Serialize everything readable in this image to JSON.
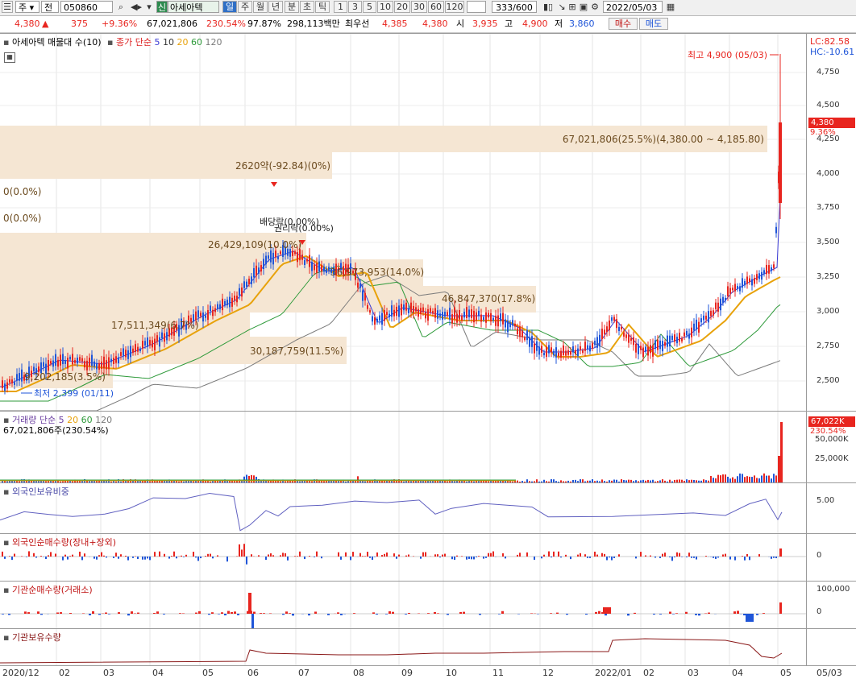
{
  "toolbar": {
    "menu_item": "주",
    "code": "050860",
    "prev_label": "전",
    "market_badge": "신",
    "stock_name": "아세아텍",
    "periods": [
      "일",
      "주",
      "월",
      "년",
      "분",
      "초",
      "틱"
    ],
    "intervals": [
      "1",
      "3",
      "5",
      "10",
      "20",
      "30",
      "60",
      "120"
    ],
    "count": "333/600",
    "date": "2022/05/03"
  },
  "quote": {
    "price": "4,380",
    "change": "375",
    "change_pct": "+9.36%",
    "volume": "67,021,806",
    "volume_ratio": "230.54%",
    "ratio2": "97.87%",
    "amount": "298,113백만",
    "best_label": "최우선",
    "best1": "4,385",
    "best2": "4,380",
    "open_label": "시",
    "open": "3,935",
    "high_label": "고",
    "high": "4,900",
    "low_label": "저",
    "low": "3,860",
    "buy": "매수",
    "sell": "매도"
  },
  "main": {
    "title": "아세아텍 매물대 수(10)",
    "ma_label": "종가 단순",
    "ma_periods": [
      "5",
      "10",
      "20",
      "60",
      "120"
    ],
    "lc": "LC:82.58",
    "hc": "HC:-10.61",
    "high_marker": "최고 4,900 (05/03)",
    "low_marker": "최저 2,399 (01/11)",
    "price_tag": "4,380",
    "price_tag_pct": "9.36%",
    "y_ticks": [
      "4,750",
      "4,500",
      "4,250",
      "4,000",
      "3,750",
      "3,500",
      "3,250",
      "3,000",
      "2,750",
      "2,500"
    ],
    "volume_profile": [
      {
        "label": "67,021,806(25.5%)(4,380.00 ~ 4,185.80)"
      },
      {
        "label": "2620약(-92.84)(0%)"
      },
      {
        "label": "0(0.0%)"
      },
      {
        "label": "0(0.0%)"
      },
      {
        "label": "26,429,109(10.0%)"
      },
      {
        "label": "36,973,953(14.0%)"
      },
      {
        "label": "46,847,370(17.8%)"
      },
      {
        "label": "17,511,349(6.7%)"
      },
      {
        "label": "30,187,759(11.5%)"
      },
      {
        "label": "9,202,185(3.5%)"
      }
    ],
    "annotation1": "배당락(0.00%)",
    "annotation2": "권리락(0.00%)"
  },
  "volume_panel": {
    "title": "거래량 단순",
    "ma_periods": [
      "5",
      "20",
      "60",
      "120"
    ],
    "value": "67,021,806주(230.54%)",
    "tag": "67,022K",
    "tag_pct": "230.54%",
    "y_ticks": [
      "50,000K",
      "25,000K"
    ]
  },
  "foreign_hold": {
    "title": "외국인보유비중",
    "y_ticks": [
      "5.00"
    ]
  },
  "foreign_net": {
    "title": "외국인순매수량(장내+장외)",
    "y_ticks": [
      "0"
    ]
  },
  "inst_net": {
    "title": "기관순매수량(거래소)",
    "y_ticks": [
      "100,000",
      "0"
    ]
  },
  "inst_hold": {
    "title": "기관보유수량"
  },
  "x_labels": [
    "2020/12",
    "02",
    "03",
    "04",
    "05",
    "06",
    "07",
    "08",
    "09",
    "10",
    "11",
    "12",
    "2022/01",
    "02",
    "03",
    "04",
    "05",
    "05/03"
  ],
  "colors": {
    "up": "#e8251f",
    "down": "#1f55d8",
    "ma5": "#3b3bd4",
    "ma20": "#e8a20b",
    "ma60": "#2e9a3a",
    "ma120": "#7a7a7a",
    "profile": "#f5e6d3"
  }
}
